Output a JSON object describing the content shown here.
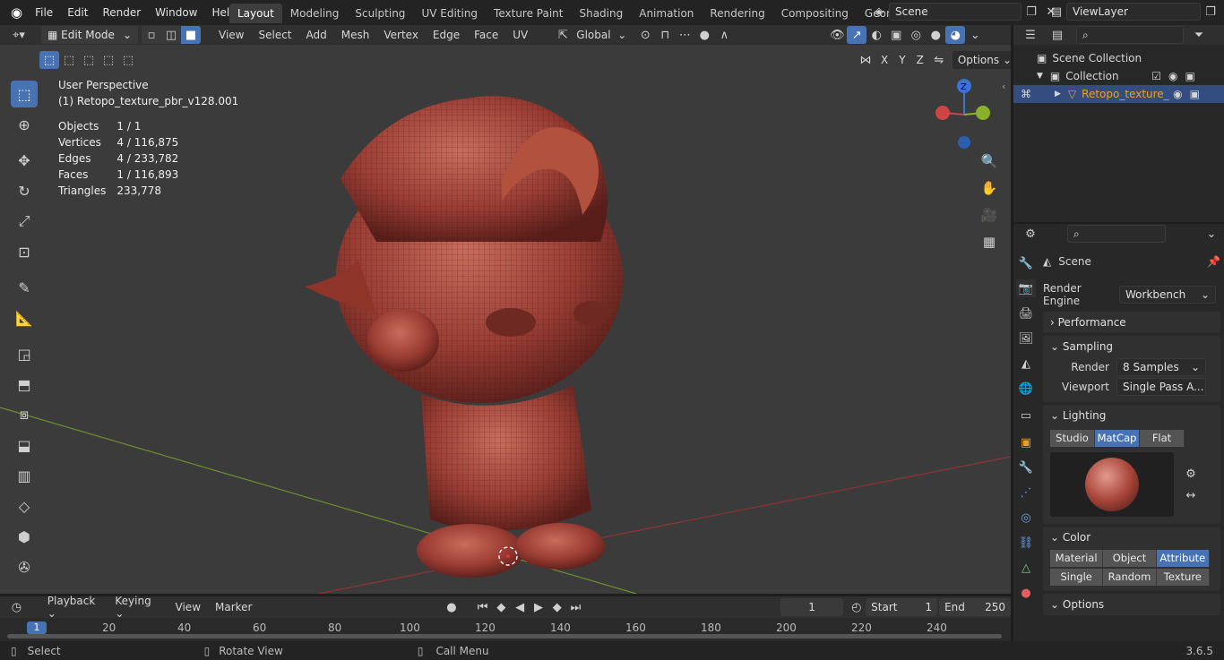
{
  "menu": {
    "logo": "blender-icon",
    "items": [
      "File",
      "Edit",
      "Render",
      "Window",
      "Help"
    ]
  },
  "workspaces": [
    "Layout",
    "Modeling",
    "Sculpting",
    "UV Editing",
    "Texture Paint",
    "Shading",
    "Animation",
    "Rendering",
    "Compositing",
    "Geometry Noc"
  ],
  "active_workspace": "Layout",
  "scene": {
    "name": "Scene",
    "view_layer": "ViewLayer"
  },
  "header": {
    "mode": "Edit Mode",
    "menus": [
      "View",
      "Select",
      "Add",
      "Mesh",
      "Vertex",
      "Edge",
      "Face",
      "UV"
    ],
    "orientation": "Global",
    "options_label": "Options",
    "axes": [
      "X",
      "Y",
      "Z"
    ]
  },
  "viewport": {
    "title": "User Perspective",
    "object_line": "(1) Retopo_texture_pbr_v128.001",
    "stats": [
      {
        "label": "Objects",
        "value": "1 / 1"
      },
      {
        "label": "Vertices",
        "value": "4 / 116,875"
      },
      {
        "label": "Edges",
        "value": "4 / 233,782"
      },
      {
        "label": "Faces",
        "value": "1 / 116,893"
      },
      {
        "label": "Triangles",
        "value": "233,778"
      }
    ],
    "gizmo_z": "Z"
  },
  "outliner": {
    "root": "Scene Collection",
    "collection": "Collection",
    "object": "Retopo_texture_"
  },
  "properties": {
    "title": "Scene",
    "render_engine_label": "Render Engine",
    "render_engine": "Workbench",
    "sections": {
      "performance": "Performance",
      "sampling": "Sampling",
      "lighting": "Lighting",
      "color": "Color",
      "options": "Options"
    },
    "sampling": {
      "render_label": "Render",
      "render_value": "8 Samples",
      "viewport_label": "Viewport",
      "viewport_value": "Single Pass A..."
    },
    "lighting_modes": [
      "Studio",
      "MatCap",
      "Flat"
    ],
    "lighting_active": "MatCap",
    "color_modes": [
      "Material",
      "Object",
      "Attribute",
      "Single",
      "Random",
      "Texture"
    ],
    "color_active": "Attribute"
  },
  "timeline": {
    "menus": [
      "Playback",
      "Keying",
      "View",
      "Marker"
    ],
    "current_frame": "1",
    "start_label": "Start",
    "start": "1",
    "end_label": "End",
    "end": "250",
    "ruler": [
      "20",
      "40",
      "60",
      "80",
      "100",
      "120",
      "140",
      "160",
      "180",
      "200",
      "220",
      "240"
    ],
    "cursor_frame": "1"
  },
  "status": {
    "select": "Select",
    "rotate": "Rotate View",
    "menu": "Call Menu",
    "version": "3.6.5"
  },
  "colors": {
    "accent": "#4772b3",
    "mesh": "#a8463a",
    "selected_object": "#f0a020"
  }
}
